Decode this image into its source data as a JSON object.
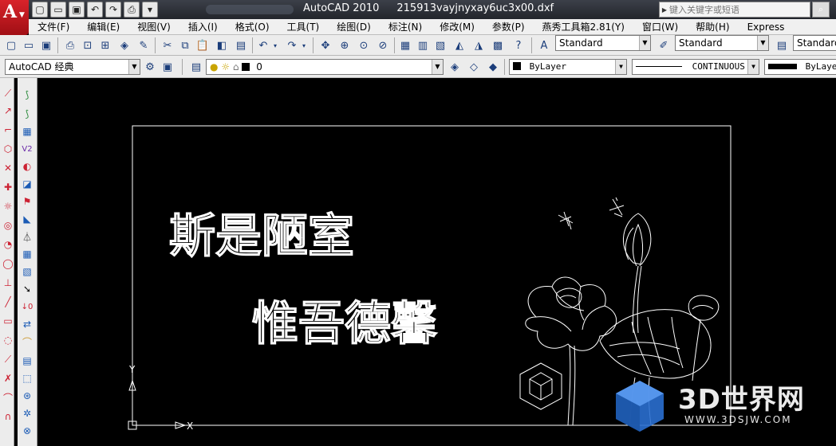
{
  "titlebar": {
    "app_title": "AutoCAD 2010",
    "file_name": "215913vayjnyxay6uc3x00.dxf",
    "search_placeholder": "键入关键字或短语"
  },
  "menu": [
    "文件(F)",
    "编辑(E)",
    "视图(V)",
    "插入(I)",
    "格式(O)",
    "工具(T)",
    "绘图(D)",
    "标注(N)",
    "修改(M)",
    "参数(P)",
    "燕秀工具箱2.81(Y)",
    "窗口(W)",
    "帮助(H)",
    "Express"
  ],
  "toolbar1": {
    "text_style": "Standard",
    "dim_style": "Standard",
    "table_style": "Standard"
  },
  "toolbar2": {
    "workspace": "AutoCAD 经典",
    "layer": "0",
    "color": "ByLayer",
    "linetype": "CONTINUOUS",
    "lineweight": "ByLayer"
  },
  "drawing": {
    "text_line1": "斯是陋室",
    "text_line2": "惟吾德馨",
    "ucs_y": "Y",
    "ucs_x": "X"
  },
  "watermark": {
    "brand": "3D世界网",
    "url": "WWW.3DSJW.COM"
  },
  "colors": {
    "titlebar": "#2b2f36",
    "canvas": "#000000",
    "logo": "#c8151c",
    "watermark_blue": "#2a6fd0"
  }
}
